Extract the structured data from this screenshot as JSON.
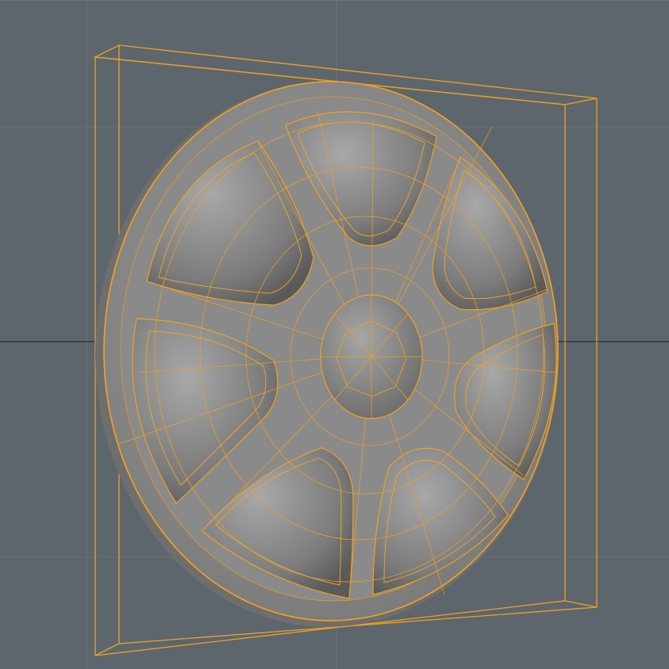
{
  "viewport": {
    "background_color": "#5d666d",
    "grid_color": "#6a737a",
    "axis_color": "#1a1a1a",
    "selection_color": "#f0a020",
    "surface_color": "#8c8c8c",
    "object": {
      "kind": "wheel-hub-mesh",
      "spokes": 7,
      "selected": true,
      "bounding_box_visible": true,
      "wireframe_overlay": true
    }
  }
}
